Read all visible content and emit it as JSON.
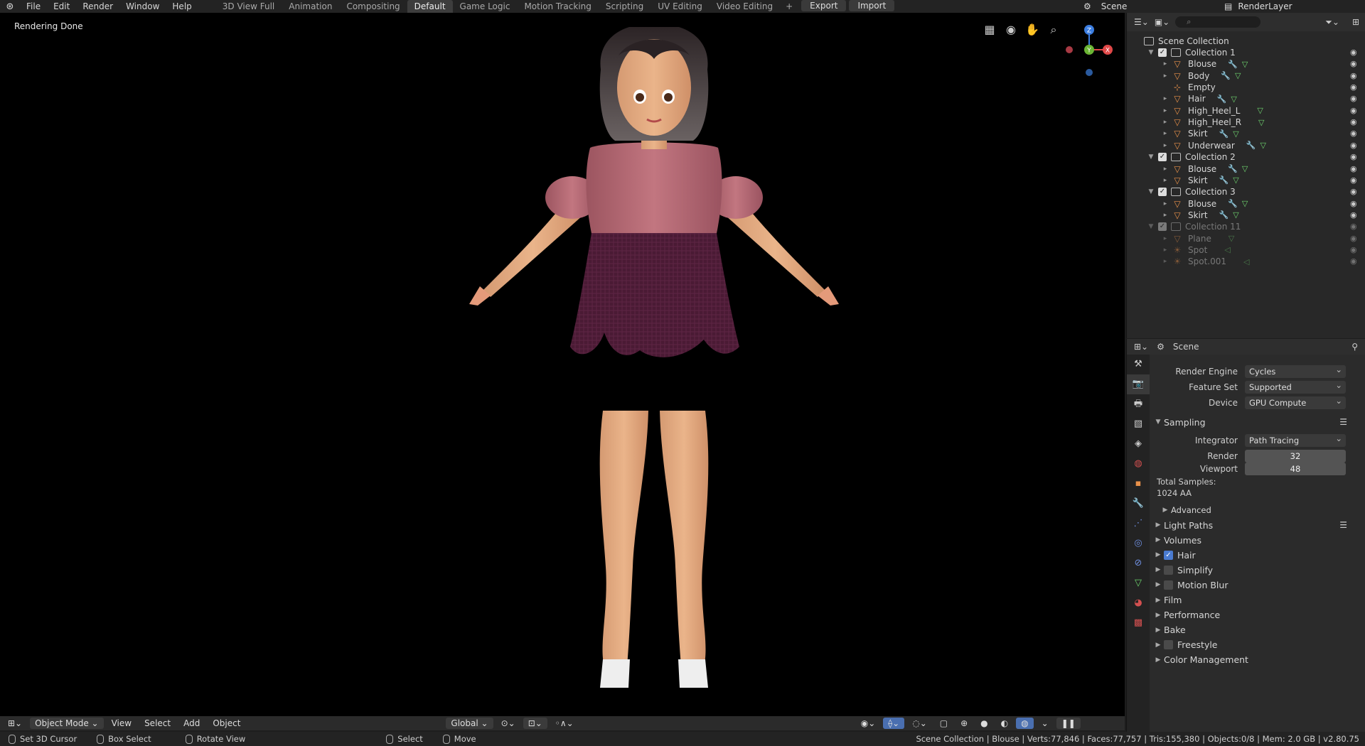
{
  "topbar": {
    "menus": [
      "File",
      "Edit",
      "Render",
      "Window",
      "Help"
    ],
    "workspaces": [
      "3D View Full",
      "Animation",
      "Compositing",
      "Default",
      "Game Logic",
      "Motion Tracking",
      "Scripting",
      "UV Editing",
      "Video Editing"
    ],
    "active_workspace": "Default",
    "export_label": "Export",
    "import_label": "Import",
    "scene_name": "Scene",
    "render_layer": "RenderLayer"
  },
  "viewport": {
    "status": "Rendering Done",
    "gizmo": {
      "x_label": "X",
      "y_label": "Y",
      "z_label": "Z"
    }
  },
  "viewport_header": {
    "mode": "Object Mode",
    "menus": [
      "View",
      "Select",
      "Add",
      "Object"
    ],
    "orientation": "Global"
  },
  "statusbar": {
    "hint1": "Set 3D Cursor",
    "hint2": "Box Select",
    "hint3": "Rotate View",
    "hint4": "Select",
    "hint5": "Move",
    "stats": "Scene Collection | Blouse | Verts:77,846 | Faces:77,757 | Tris:155,380 | Objects:0/8 | Mem: 2.0 GB | v2.80.75"
  },
  "outliner": {
    "root": "Scene Collection",
    "rows": [
      {
        "name": "Collection 1",
        "kind": "collection"
      },
      {
        "name": "Blouse",
        "kind": "object"
      },
      {
        "name": "Body",
        "kind": "object"
      },
      {
        "name": "Empty",
        "kind": "empty"
      },
      {
        "name": "Hair",
        "kind": "object"
      },
      {
        "name": "High_Heel_L",
        "kind": "object"
      },
      {
        "name": "High_Heel_R",
        "kind": "object"
      },
      {
        "name": "Skirt",
        "kind": "object"
      },
      {
        "name": "Underwear",
        "kind": "object"
      },
      {
        "name": "Collection 2",
        "kind": "collection"
      },
      {
        "name": "Blouse",
        "kind": "object"
      },
      {
        "name": "Skirt",
        "kind": "object"
      },
      {
        "name": "Collection 3",
        "kind": "collection"
      },
      {
        "name": "Blouse",
        "kind": "object"
      },
      {
        "name": "Skirt",
        "kind": "object"
      },
      {
        "name": "Collection 11",
        "kind": "collection"
      },
      {
        "name": "Plane",
        "kind": "object"
      },
      {
        "name": "Spot",
        "kind": "light"
      },
      {
        "name": "Spot.001",
        "kind": "light"
      }
    ]
  },
  "properties": {
    "context": "Scene",
    "render_engine_label": "Render Engine",
    "render_engine": "Cycles",
    "feature_set_label": "Feature Set",
    "feature_set": "Supported",
    "device_label": "Device",
    "device": "GPU Compute",
    "sampling_label": "Sampling",
    "integrator_label": "Integrator",
    "integrator": "Path Tracing",
    "render_label": "Render",
    "render_samples": "32",
    "viewport_label": "Viewport",
    "viewport_samples": "48",
    "total_samples_label": "Total Samples:",
    "total_samples_value": "1024 AA",
    "advanced_label": "Advanced",
    "sections": [
      "Light Paths",
      "Volumes",
      "Hair",
      "Simplify",
      "Motion Blur",
      "Film",
      "Performance",
      "Bake",
      "Freestyle",
      "Color Management"
    ]
  }
}
